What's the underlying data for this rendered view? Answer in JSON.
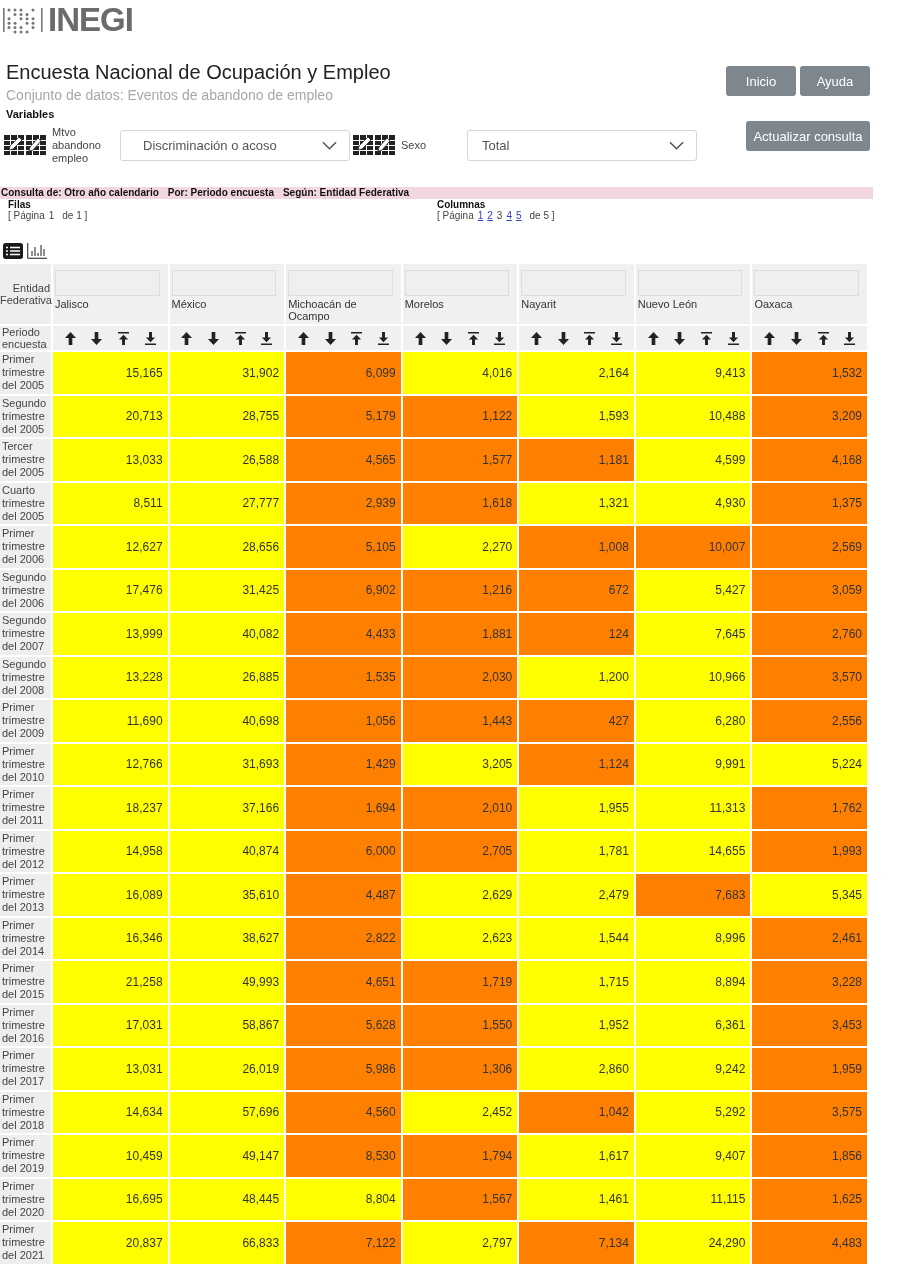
{
  "header": {
    "logo_text": "INEGI",
    "title": "Encuesta Nacional de Ocupación y Empleo",
    "subtitle": "Conjunto de datos: Eventos de abandono de empleo",
    "buttons": [
      "Inicio",
      "Ayuda"
    ]
  },
  "variables": {
    "label": "Variables",
    "items": [
      {
        "name": "Mtvo abandono empleo",
        "value": "Discriminación o acoso"
      },
      {
        "name": "Sexo",
        "value": "Total"
      }
    ],
    "submit": "Actualizar consulta"
  },
  "query_bar": [
    "Consulta de: Otro año calendario",
    "Por: Periodo encuesta",
    "Según: Entidad Federativa"
  ],
  "pagination": [
    {
      "title": "Filas",
      "prefix": "[ Página",
      "pages": [
        {
          "label": "1",
          "selected": true
        }
      ],
      "suffix": "de 1 ]"
    },
    {
      "title": "Columnas",
      "prefix": "[ Página",
      "pages": [
        {
          "label": "1",
          "selected": false
        },
        {
          "label": "2",
          "selected": false
        },
        {
          "label": "3",
          "selected": true
        },
        {
          "label": "4",
          "selected": false
        },
        {
          "label": "5",
          "selected": false
        }
      ],
      "suffix": "de 5 ]"
    }
  ],
  "view_toggle": [
    {
      "kind": "list",
      "selected": true
    },
    {
      "kind": "chart",
      "selected": false
    }
  ],
  "table": {
    "corner_top": "Entidad Federativa",
    "corner_bottom": "Periodo encuesta",
    "columns": [
      "Jalisco",
      "México",
      "Michoacán de Ocampo",
      "Morelos",
      "Nayarit",
      "Nuevo León",
      "Oaxaca"
    ],
    "rows": [
      {
        "label": "Primer trimestre del 2005",
        "cells": [
          {
            "value": "15,165",
            "color": "#ffff00"
          },
          {
            "value": "31,902",
            "color": "#ffff00"
          },
          {
            "value": "6,099",
            "color": "#ff8000"
          },
          {
            "value": "4,016",
            "color": "#ffff00"
          },
          {
            "value": "2,164",
            "color": "#ffff00"
          },
          {
            "value": "9,413",
            "color": "#ffff00"
          },
          {
            "value": "1,532",
            "color": "#ff8000"
          }
        ]
      },
      {
        "label": "Segundo trimestre del 2005",
        "cells": [
          {
            "value": "20,713",
            "color": "#ffff00"
          },
          {
            "value": "28,755",
            "color": "#ffff00"
          },
          {
            "value": "5,179",
            "color": "#ff8000"
          },
          {
            "value": "1,122",
            "color": "#ff8000"
          },
          {
            "value": "1,593",
            "color": "#ffff00"
          },
          {
            "value": "10,488",
            "color": "#ffff00"
          },
          {
            "value": "3,209",
            "color": "#ff8000"
          }
        ]
      },
      {
        "label": "Tercer trimestre del 2005",
        "cells": [
          {
            "value": "13,033",
            "color": "#ffff00"
          },
          {
            "value": "26,588",
            "color": "#ffff00"
          },
          {
            "value": "4,565",
            "color": "#ff8000"
          },
          {
            "value": "1,577",
            "color": "#ff8000"
          },
          {
            "value": "1,181",
            "color": "#ff8000"
          },
          {
            "value": "4,599",
            "color": "#ffff00"
          },
          {
            "value": "4,168",
            "color": "#ff8000"
          }
        ]
      },
      {
        "label": "Cuarto trimestre del 2005",
        "cells": [
          {
            "value": "8,511",
            "color": "#ffff00"
          },
          {
            "value": "27,777",
            "color": "#ffff00"
          },
          {
            "value": "2,939",
            "color": "#ff8000"
          },
          {
            "value": "1,618",
            "color": "#ff8000"
          },
          {
            "value": "1,321",
            "color": "#ffff00"
          },
          {
            "value": "4,930",
            "color": "#ffff00"
          },
          {
            "value": "1,375",
            "color": "#ff8000"
          }
        ]
      },
      {
        "label": "Primer trimestre del 2006",
        "cells": [
          {
            "value": "12,627",
            "color": "#ffff00"
          },
          {
            "value": "28,656",
            "color": "#ffff00"
          },
          {
            "value": "5,105",
            "color": "#ff8000"
          },
          {
            "value": "2,270",
            "color": "#ffff00"
          },
          {
            "value": "1,008",
            "color": "#ff8000"
          },
          {
            "value": "10,007",
            "color": "#ff8000"
          },
          {
            "value": "2,569",
            "color": "#ff8000"
          }
        ]
      },
      {
        "label": "Segundo trimestre del 2006",
        "cells": [
          {
            "value": "17,476",
            "color": "#ffff00"
          },
          {
            "value": "31,425",
            "color": "#ffff00"
          },
          {
            "value": "6,902",
            "color": "#ff8000"
          },
          {
            "value": "1,216",
            "color": "#ff8000"
          },
          {
            "value": "672",
            "color": "#ff8000"
          },
          {
            "value": "5,427",
            "color": "#ffff00"
          },
          {
            "value": "3,059",
            "color": "#ff8000"
          }
        ]
      },
      {
        "label": "Segundo trimestre del 2007",
        "cells": [
          {
            "value": "13,999",
            "color": "#ffff00"
          },
          {
            "value": "40,082",
            "color": "#ffff00"
          },
          {
            "value": "4,433",
            "color": "#ff8000"
          },
          {
            "value": "1,881",
            "color": "#ff8000"
          },
          {
            "value": "124",
            "color": "#ff8000"
          },
          {
            "value": "7,645",
            "color": "#ffff00"
          },
          {
            "value": "2,760",
            "color": "#ff8000"
          }
        ]
      },
      {
        "label": "Segundo trimestre del 2008",
        "cells": [
          {
            "value": "13,228",
            "color": "#ffff00"
          },
          {
            "value": "26,885",
            "color": "#ffff00"
          },
          {
            "value": "1,535",
            "color": "#ff8000"
          },
          {
            "value": "2,030",
            "color": "#ff8000"
          },
          {
            "value": "1,200",
            "color": "#ffff00"
          },
          {
            "value": "10,966",
            "color": "#ffff00"
          },
          {
            "value": "3,570",
            "color": "#ff8000"
          }
        ]
      },
      {
        "label": "Primer trimestre del 2009",
        "cells": [
          {
            "value": "11,690",
            "color": "#ffff00"
          },
          {
            "value": "40,698",
            "color": "#ffff00"
          },
          {
            "value": "1,056",
            "color": "#ff8000"
          },
          {
            "value": "1,443",
            "color": "#ff8000"
          },
          {
            "value": "427",
            "color": "#ff8000"
          },
          {
            "value": "6,280",
            "color": "#ffff00"
          },
          {
            "value": "2,556",
            "color": "#ff8000"
          }
        ]
      },
      {
        "label": "Primer trimestre del 2010",
        "cells": [
          {
            "value": "12,766",
            "color": "#ffff00"
          },
          {
            "value": "31,693",
            "color": "#ffff00"
          },
          {
            "value": "1,429",
            "color": "#ff8000"
          },
          {
            "value": "3,205",
            "color": "#ffff00"
          },
          {
            "value": "1,124",
            "color": "#ff8000"
          },
          {
            "value": "9,991",
            "color": "#ffff00"
          },
          {
            "value": "5,224",
            "color": "#ffff00"
          }
        ]
      },
      {
        "label": "Primer trimestre del 2011",
        "cells": [
          {
            "value": "18,237",
            "color": "#ffff00"
          },
          {
            "value": "37,166",
            "color": "#ffff00"
          },
          {
            "value": "1,694",
            "color": "#ff8000"
          },
          {
            "value": "2,010",
            "color": "#ff8000"
          },
          {
            "value": "1,955",
            "color": "#ffff00"
          },
          {
            "value": "11,313",
            "color": "#ffff00"
          },
          {
            "value": "1,762",
            "color": "#ff8000"
          }
        ]
      },
      {
        "label": "Primer trimestre del 2012",
        "cells": [
          {
            "value": "14,958",
            "color": "#ffff00"
          },
          {
            "value": "40,874",
            "color": "#ffff00"
          },
          {
            "value": "6,000",
            "color": "#ff8000"
          },
          {
            "value": "2,705",
            "color": "#ff8000"
          },
          {
            "value": "1,781",
            "color": "#ffff00"
          },
          {
            "value": "14,655",
            "color": "#ffff00"
          },
          {
            "value": "1,993",
            "color": "#ff8000"
          }
        ]
      },
      {
        "label": "Primer trimestre del 2013",
        "cells": [
          {
            "value": "16,089",
            "color": "#ffff00"
          },
          {
            "value": "35,610",
            "color": "#ffff00"
          },
          {
            "value": "4,487",
            "color": "#ff8000"
          },
          {
            "value": "2,629",
            "color": "#ffff00"
          },
          {
            "value": "2,479",
            "color": "#ffff00"
          },
          {
            "value": "7,683",
            "color": "#ff8000"
          },
          {
            "value": "5,345",
            "color": "#ffff00"
          }
        ]
      },
      {
        "label": "Primer trimestre del 2014",
        "cells": [
          {
            "value": "16,346",
            "color": "#ffff00"
          },
          {
            "value": "38,627",
            "color": "#ffff00"
          },
          {
            "value": "2,822",
            "color": "#ff8000"
          },
          {
            "value": "2,623",
            "color": "#ffff00"
          },
          {
            "value": "1,544",
            "color": "#ffff00"
          },
          {
            "value": "8,996",
            "color": "#ffff00"
          },
          {
            "value": "2,461",
            "color": "#ff8000"
          }
        ]
      },
      {
        "label": "Primer trimestre del 2015",
        "cells": [
          {
            "value": "21,258",
            "color": "#ffff00"
          },
          {
            "value": "49,993",
            "color": "#ffff00"
          },
          {
            "value": "4,651",
            "color": "#ff8000"
          },
          {
            "value": "1,719",
            "color": "#ff8000"
          },
          {
            "value": "1,715",
            "color": "#ffff00"
          },
          {
            "value": "8,894",
            "color": "#ffff00"
          },
          {
            "value": "3,228",
            "color": "#ff8000"
          }
        ]
      },
      {
        "label": "Primer trimestre del 2016",
        "cells": [
          {
            "value": "17,031",
            "color": "#ffff00"
          },
          {
            "value": "58,867",
            "color": "#ffff00"
          },
          {
            "value": "5,628",
            "color": "#ff8000"
          },
          {
            "value": "1,550",
            "color": "#ff8000"
          },
          {
            "value": "1,952",
            "color": "#ffff00"
          },
          {
            "value": "6,361",
            "color": "#ffff00"
          },
          {
            "value": "3,453",
            "color": "#ff8000"
          }
        ]
      },
      {
        "label": "Primer trimestre del 2017",
        "cells": [
          {
            "value": "13,031",
            "color": "#ffff00"
          },
          {
            "value": "26,019",
            "color": "#ffff00"
          },
          {
            "value": "5,986",
            "color": "#ff8000"
          },
          {
            "value": "1,306",
            "color": "#ff8000"
          },
          {
            "value": "2,860",
            "color": "#ffff00"
          },
          {
            "value": "9,242",
            "color": "#ffff00"
          },
          {
            "value": "1,959",
            "color": "#ff8000"
          }
        ]
      },
      {
        "label": "Primer trimestre del 2018",
        "cells": [
          {
            "value": "14,634",
            "color": "#ffff00"
          },
          {
            "value": "57,696",
            "color": "#ffff00"
          },
          {
            "value": "4,560",
            "color": "#ff8000"
          },
          {
            "value": "2,452",
            "color": "#ffff00"
          },
          {
            "value": "1,042",
            "color": "#ff8000"
          },
          {
            "value": "5,292",
            "color": "#ffff00"
          },
          {
            "value": "3,575",
            "color": "#ff8000"
          }
        ]
      },
      {
        "label": "Primer trimestre del 2019",
        "cells": [
          {
            "value": "10,459",
            "color": "#ffff00"
          },
          {
            "value": "49,147",
            "color": "#ffff00"
          },
          {
            "value": "8,530",
            "color": "#ff8000"
          },
          {
            "value": "1,794",
            "color": "#ff8000"
          },
          {
            "value": "1,617",
            "color": "#ffff00"
          },
          {
            "value": "9,407",
            "color": "#ffff00"
          },
          {
            "value": "1,856",
            "color": "#ff8000"
          }
        ]
      },
      {
        "label": "Primer trimestre del 2020",
        "cells": [
          {
            "value": "16,695",
            "color": "#ffff00"
          },
          {
            "value": "48,445",
            "color": "#ffff00"
          },
          {
            "value": "8,804",
            "color": "#ffff00"
          },
          {
            "value": "1,567",
            "color": "#ff8000"
          },
          {
            "value": "1,461",
            "color": "#ffff00"
          },
          {
            "value": "11,115",
            "color": "#ffff00"
          },
          {
            "value": "1,625",
            "color": "#ff8000"
          }
        ]
      },
      {
        "label": "Primer trimestre del 2021",
        "cells": [
          {
            "value": "20,837",
            "color": "#ffff00"
          },
          {
            "value": "66,833",
            "color": "#ffff00"
          },
          {
            "value": "7,122",
            "color": "#ff8000"
          },
          {
            "value": "2,797",
            "color": "#ffff00"
          },
          {
            "value": "7,134",
            "color": "#ff8000"
          },
          {
            "value": "24,290",
            "color": "#ffff00"
          },
          {
            "value": "4,483",
            "color": "#ff8000"
          }
        ]
      }
    ]
  }
}
